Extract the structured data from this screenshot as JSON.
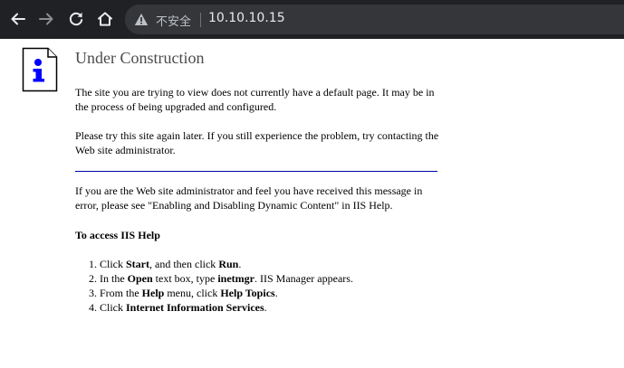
{
  "browser": {
    "security_label": "不安全",
    "url": "10.10.10.15",
    "icons": [
      "back-icon",
      "forward-icon",
      "reload-icon",
      "home-icon",
      "warning-icon"
    ]
  },
  "page": {
    "title": "Under Construction",
    "para1": "The site you are trying to view does not currently have a default page. It may be in the process of being upgraded and configured.",
    "para2": "Please try this site again later. If you still experience the problem, try contacting the Web site administrator.",
    "para3": "If you are the Web site administrator and feel you have received this message in error, please see \"Enabling and Disabling Dynamic Content\" in IIS Help.",
    "heading": "To access IIS Help",
    "steps": [
      {
        "num": "1.",
        "a": "Click ",
        "b": "Start",
        "c": ", and then click ",
        "d": "Run",
        "e": "."
      },
      {
        "num": "2.",
        "a": "In the ",
        "b": "Open",
        "c": " text box, type ",
        "d": "inetmgr",
        "e": ". IIS Manager appears."
      },
      {
        "num": "3.",
        "a": "From the ",
        "b": "Help",
        "c": " menu, click ",
        "d": "Help Topics",
        "e": "."
      },
      {
        "num": "4.",
        "a": "Click ",
        "b": "Internet Information Services",
        "c": ".",
        "d": "",
        "e": ""
      }
    ]
  },
  "colors": {
    "toolbar_bg": "#202124",
    "omnibox_bg": "#35363a",
    "rule": "#0000aa",
    "icon_blue": "#0000ff",
    "title_gray": "#4b4b4b"
  }
}
